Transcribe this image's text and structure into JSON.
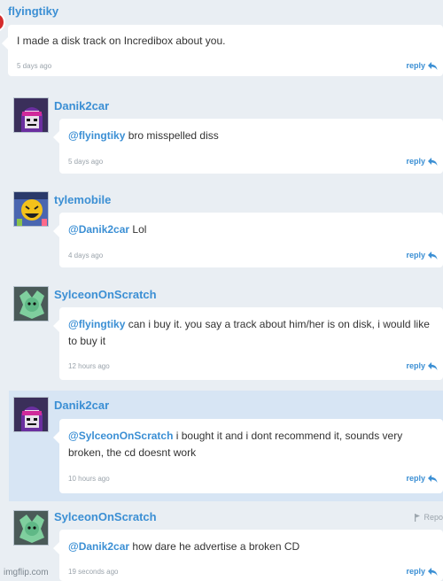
{
  "comments": [
    {
      "author": "flyingtiky",
      "text": "I made a disk track on Incredibox about you.",
      "time": "5 days ago",
      "reply": "reply"
    },
    {
      "author": "Danik2car",
      "mention": "@flyingtiky",
      "text": " bro misspelled diss",
      "time": "5 days ago",
      "reply": "reply"
    },
    {
      "author": "tylemobile",
      "mention": "@Danik2car",
      "text": " Lol",
      "time": "4 days ago",
      "reply": "reply"
    },
    {
      "author": "SylceonOnScratch",
      "mention": "@flyingtiky",
      "text": " can i buy it. you say a track about him/her is on disk, i would like to buy it",
      "time": "12 hours ago",
      "reply": "reply"
    },
    {
      "author": "Danik2car",
      "mention": "@SylceonOnScratch",
      "text": " i bought it and i dont recommend it, sounds very broken, the cd doesnt work",
      "time": "10 hours ago",
      "reply": "reply"
    },
    {
      "author": "SylceonOnScratch",
      "mention": "@Danik2car",
      "text": " how dare he advertise a broken CD",
      "time": "19 seconds ago",
      "reply": "reply",
      "report": "Repo"
    }
  ],
  "watermark": "imgflip.com",
  "colors": {
    "link": "#3b8fd4",
    "background": "#e9eef3",
    "highlight": "#d7e5f4"
  }
}
